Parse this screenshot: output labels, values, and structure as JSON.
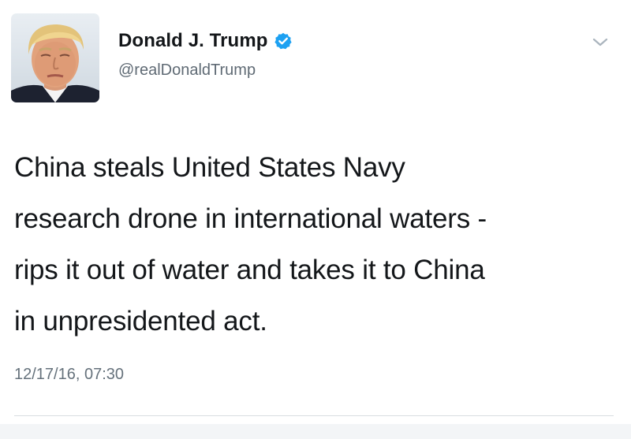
{
  "author": {
    "display_name": "Donald J. Trump",
    "handle": "@realDonaldTrump",
    "verified": true,
    "avatar_icon": "profile-photo",
    "verified_icon": "verified-badge-icon"
  },
  "tweet": {
    "text_lines": [
      "China steals United States Navy",
      "research drone in international waters -",
      "rips it out of water and takes it to China",
      "in unpresidented act."
    ],
    "timestamp": "12/17/16, 07:30"
  },
  "menu": {
    "icon": "chevron-down-icon"
  },
  "colors": {
    "verified_blue": "#1da1f2",
    "text": "#14171a",
    "secondary_text": "#5f6a74",
    "divider": "#d8dde1"
  }
}
